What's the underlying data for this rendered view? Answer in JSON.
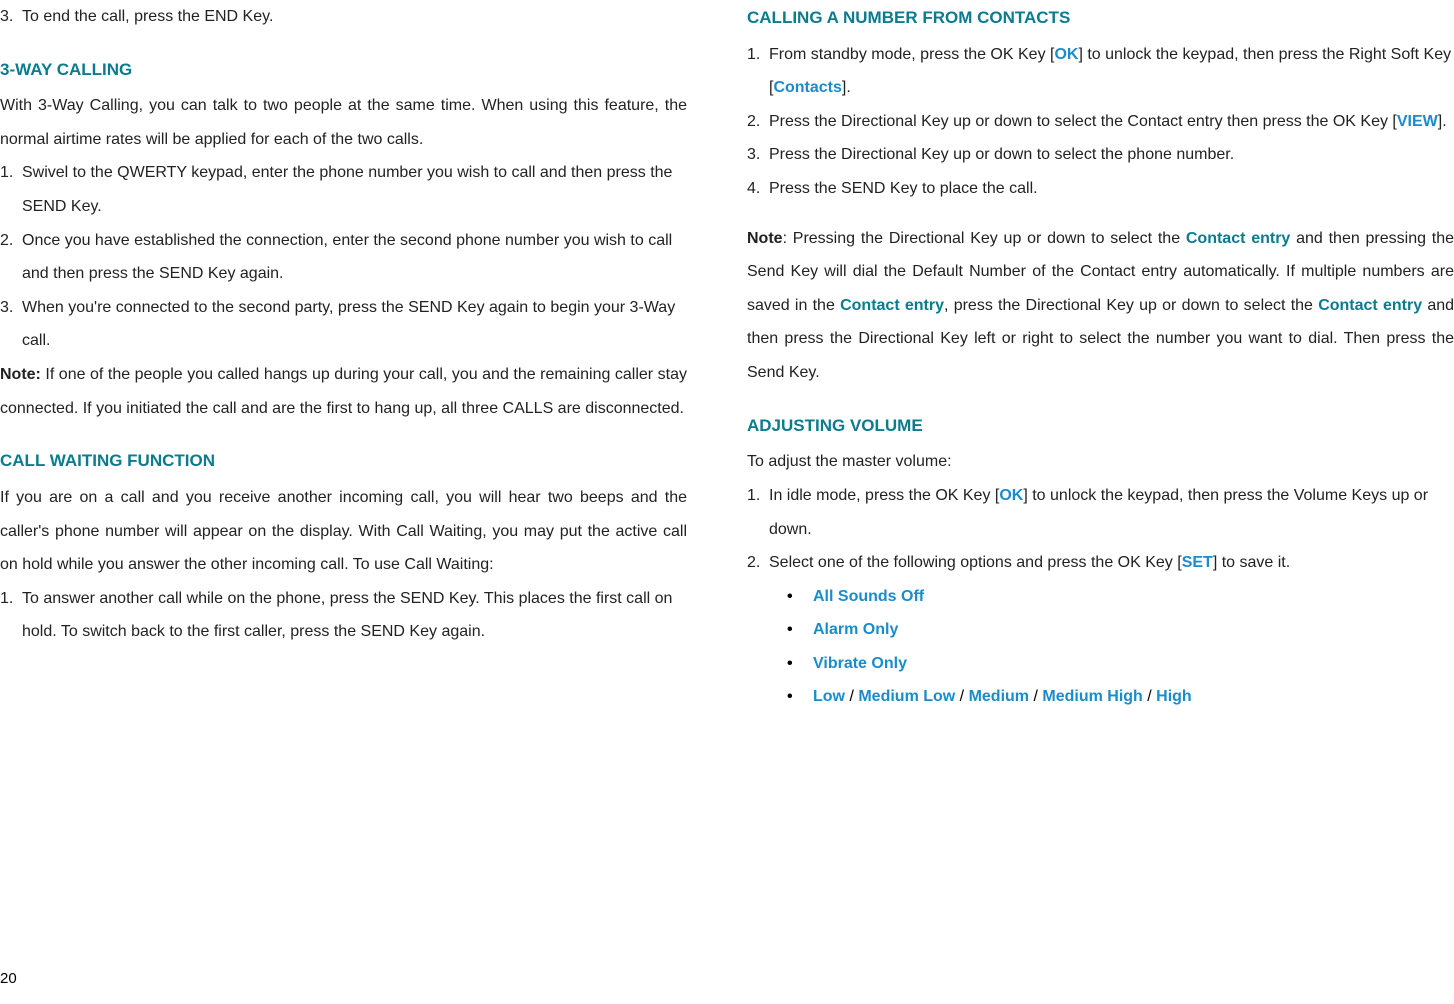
{
  "left": {
    "step3": {
      "num": "3.",
      "text": "To end the call, press the END Key."
    },
    "h1": "3-WAY CALLING",
    "p1": "With 3-Way Calling, you can talk to two people at the same time. When using this feature, the normal airtime rates will be applied for each of the two calls.",
    "s1": {
      "num": "1.",
      "text": "Swivel to the QWERTY keypad, enter the phone number you wish to call and then press the SEND Key."
    },
    "s2": {
      "num": "2.",
      "text": "Once you have established the connection, enter the second phone number you wish to call and then press the SEND Key again."
    },
    "s3": {
      "num": "3.",
      "text": "When you're connected to the second party, press the SEND Key again to begin your 3-Way call."
    },
    "note1_label": "Note:",
    "note1_text": " If one of the people you called hangs up during your call, you and the remaining caller stay connected. If you initiated the call and are the first to hang up, all three CALLS are disconnected.",
    "h2": "CALL WAITING FUNCTION",
    "p2": "If you are on a call and you receive another incoming call, you will hear two beeps and the caller's phone number will appear on the display. With Call Waiting, you may put the active call on hold while you answer the other incoming call. To use Call Waiting:",
    "cw1": {
      "num": "1.",
      "text": "To answer another call while on the phone, press the SEND Key. This places the first call on hold. To switch back to the first caller, press the SEND Key again."
    },
    "page_num": "20"
  },
  "right": {
    "h1": "CALLING A NUMBER FROM CONTACTS",
    "s1": {
      "num": "1.",
      "pre": "From standby mode, press the OK Key [",
      "key1": "OK",
      "mid": "] to unlock the keypad, then press the Right Soft Key [",
      "key2": "Contacts",
      "post": "]."
    },
    "s2": {
      "num": "2.",
      "pre": "Press the Directional Key up or down to select the Contact entry then press the OK Key [",
      "key": "VIEW",
      "post": "]."
    },
    "s3": {
      "num": "3.",
      "text": "Press the Directional Key up or down to select the phone number."
    },
    "s4": {
      "num": "4.",
      "text": "Press the SEND Key to place the call."
    },
    "note_label": "Note",
    "note_a": ": Pressing the Directional Key up or down to select the ",
    "note_ce1": "Contact entry",
    "note_b": " and then pressing the Send Key will dial the Default Number of the Contact entry automatically. If multiple numbers are saved in the ",
    "note_ce2": "Contact entry",
    "note_c": ", press the Directional Key up or down to select the ",
    "note_ce3": "Contact entry",
    "note_d": " and then press the Directional Key left or right to select the number you want to dial. Then press the Send Key.",
    "h2": "ADJUSTING VOLUME",
    "p2": "To adjust the master volume:",
    "v1": {
      "num": "1.",
      "pre": "In idle mode, press the OK Key [",
      "key": "OK",
      "post": "] to unlock the keypad, then press the Volume Keys up or down."
    },
    "v2": {
      "num": "2.",
      "pre": "Select one of the following options and press the OK Key [",
      "key": "SET",
      "post": "] to save it."
    },
    "b1": "All Sounds Off",
    "b2": "Alarm Only",
    "b3": "Vibrate Only",
    "b4_1": "Low",
    "b4_s1": " / ",
    "b4_2": "Medium Low",
    "b4_s2": " / ",
    "b4_3": "Medium",
    "b4_s3": " / ",
    "b4_4": "Medium High",
    "b4_s4": " / ",
    "b4_5": "High",
    "bullet": "•"
  }
}
